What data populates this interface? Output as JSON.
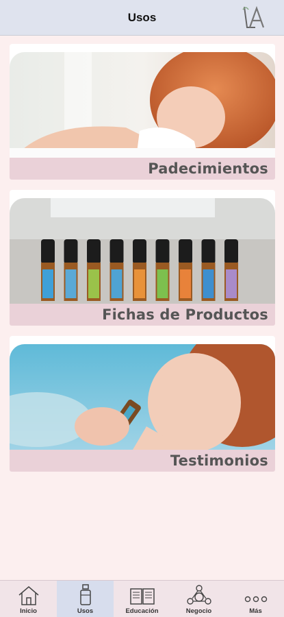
{
  "header": {
    "title": "Usos",
    "logo_icon": "la-logo-icon"
  },
  "cards": [
    {
      "label": "Padecimientos",
      "image": "child-resting-with-tissue"
    },
    {
      "label": "Fichas de Productos",
      "image": "roller-bottles-row"
    },
    {
      "label": "Testimonios",
      "image": "woman-smelling-oil-bottle"
    }
  ],
  "tabs": [
    {
      "label": "Inicio",
      "icon": "home-icon",
      "active": false
    },
    {
      "label": "Usos",
      "icon": "bottle-icon",
      "active": true
    },
    {
      "label": "Educación",
      "icon": "book-icon",
      "active": false
    },
    {
      "label": "Negocio",
      "icon": "network-icon",
      "active": false
    },
    {
      "label": "Más",
      "icon": "more-dots-icon",
      "active": false
    }
  ],
  "colors": {
    "header_bg": "#dfe3ee",
    "page_bg": "#fcefef",
    "label_bar": "#ead1d8",
    "active_tab": "#d7dded"
  }
}
